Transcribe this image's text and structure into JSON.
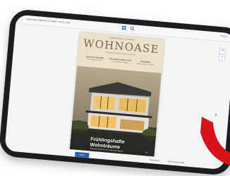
{
  "app": {
    "breadcrumb": "Augsburger Allgemeine (Stadt) > 06.01.2024",
    "pages_link": "Seiten >",
    "footer_left": "Impressum",
    "footer_right": "Datenschutz  AGB",
    "bottom_tab": "Lesen"
  },
  "icons": {
    "grid": "grid-icon",
    "search": "search-icon",
    "plus": "+",
    "minus": "−",
    "next": "›"
  },
  "cover": {
    "kicker": "AUGSBURGER ALLGEMEINE",
    "masthead": "WOHNOASE",
    "subline": "Das Magazin für Bauen, Wohnen und Garten",
    "teasers": [
      {
        "title": "GARTENTRÄUME",
        "text": "Ideen für grüne Oasen"
      },
      {
        "title": "TRAUMHÄUSER 2024",
        "text": "Neue Trends im Hausbau"
      },
      {
        "title": "ENERGIE",
        "text": "Clever sparen zu Hause"
      }
    ],
    "headline_line1": "Frühlingshafte",
    "headline_line2": "Wohnträume",
    "sub": "Tipps und Trends für ein modernes Zuhause",
    "badge": "AZ"
  },
  "colors": {
    "accent": "#3a66b5",
    "ribbon": "#d5141a",
    "cover_bg": "#e8dcc4"
  }
}
